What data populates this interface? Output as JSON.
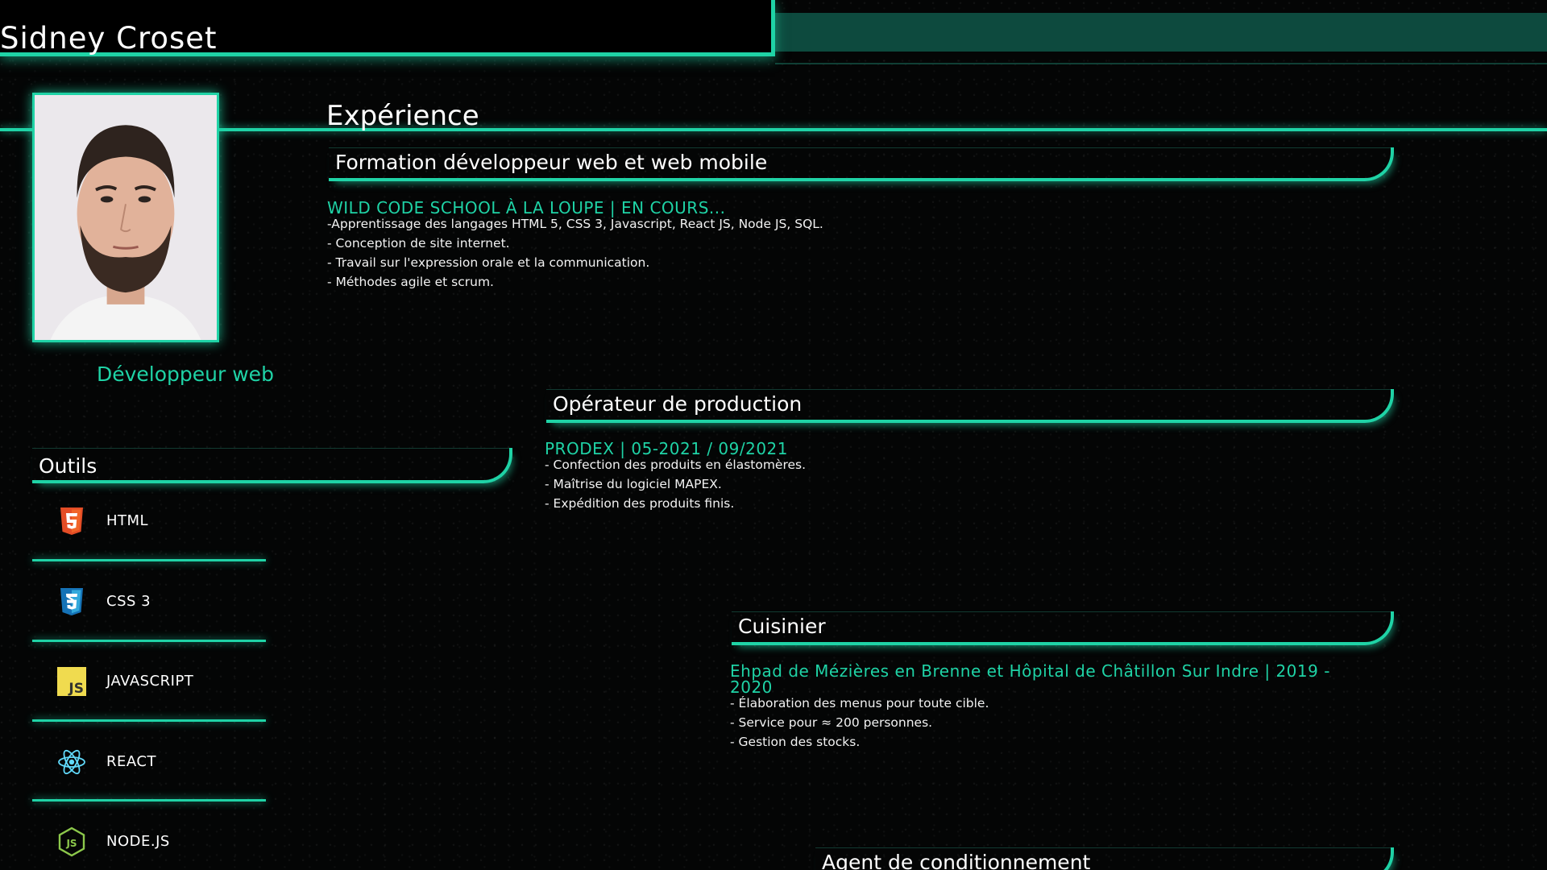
{
  "header": {
    "title": "Sidney Croset"
  },
  "profile": {
    "job_title": "Développeur web"
  },
  "experience": {
    "heading": "Expérience",
    "items": [
      {
        "title": "Formation développeur web et web mobile",
        "org": "WILD CODE SCHOOL À LA LOUPE | EN COURS...",
        "desc": "-Apprentissage des langages HTML 5, CSS 3, Javascript, React JS, Node JS, SQL.\n- Conception de site internet.\n- Travail sur l'expression orale et la communication.\n- Méthodes agile et scrum."
      },
      {
        "title": "Opérateur de production",
        "org": "PRODEX | 05-2021 / 09/2021",
        "desc": "- Confection des produits en élastomères.\n- Maîtrise du logiciel MAPEX.\n- Expédition des produits finis."
      },
      {
        "title": "Cuisinier",
        "org": "Ehpad de Mézières en Brenne et Hôpital de Châtillon Sur Indre | 2019 - 2020",
        "desc": "- Élaboration des menus pour toute cible.\n- Service pour ≈ 200 personnes.\n- Gestion des stocks."
      },
      {
        "title": "Agent de conditionnement"
      }
    ]
  },
  "tools": {
    "heading": "Outils",
    "items": [
      {
        "label": "HTML",
        "icon": "html5-icon",
        "color": "#e44d26"
      },
      {
        "label": "CSS 3",
        "icon": "css3-icon",
        "color": "#1572b6"
      },
      {
        "label": "JAVASCRIPT",
        "icon": "javascript-icon",
        "color": "#f0db4f"
      },
      {
        "label": "REACT",
        "icon": "react-icon",
        "color": "#61dafb"
      },
      {
        "label": "NODE.JS",
        "icon": "nodejs-icon",
        "color": "#8cc84b"
      }
    ]
  },
  "colors": {
    "accent": "#1fd3a6",
    "background": "#050606",
    "header_band": "#0d4a3e"
  }
}
